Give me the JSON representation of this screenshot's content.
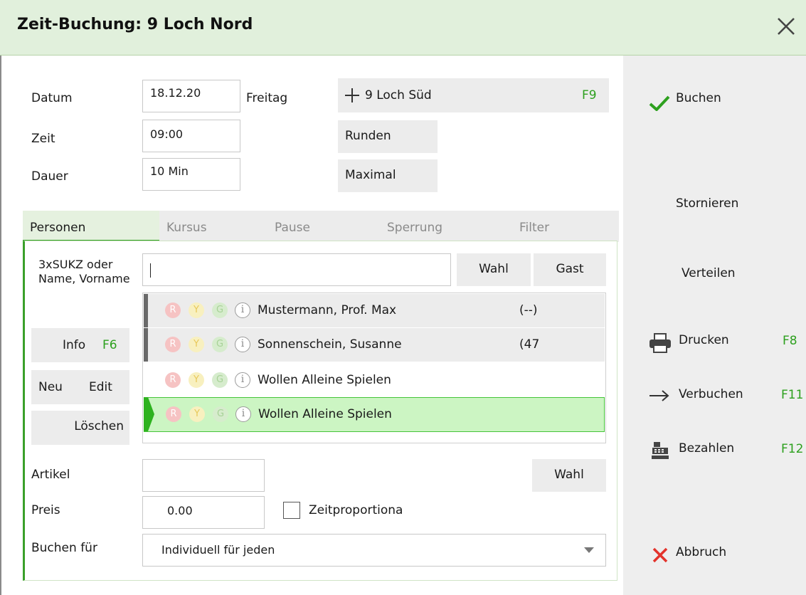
{
  "window": {
    "title": "Zeit-Buchung: 9 Loch Nord"
  },
  "form": {
    "datum_label": "Datum",
    "datum_value": "18.12.20",
    "weekday": "Freitag",
    "zeit_label": "Zeit",
    "zeit_value": "09:00",
    "dauer_label": "Dauer",
    "dauer_value": "10 Min"
  },
  "course_button": {
    "label": "9 Loch Süd",
    "key": "F9"
  },
  "runden_button": "Runden",
  "maximal_button": "Maximal",
  "tabs": [
    "Personen",
    "Kursus",
    "Pause",
    "Sperrung",
    "Filter"
  ],
  "search": {
    "label": "3xSUKZ oder Name, Vorname",
    "value": "",
    "wahl": "Wahl",
    "gast": "Gast"
  },
  "left_buttons": {
    "info": "Info",
    "info_key": "F6",
    "neu": "Neu",
    "edit": "Edit",
    "loeschen": "Löschen"
  },
  "persons": [
    {
      "name": "Mustermann, Prof. Max",
      "status": "(--)",
      "style": "gray"
    },
    {
      "name": "Sonnenschein, Susanne",
      "status": "(47",
      "style": "gray"
    },
    {
      "name": "Wollen Alleine Spielen",
      "status": "",
      "style": "plain"
    },
    {
      "name": "Wollen Alleine Spielen",
      "status": "",
      "style": "selected"
    }
  ],
  "status_letters": {
    "r": "R",
    "y": "Y",
    "g": "G",
    "i": "i"
  },
  "artikel": {
    "label": "Artikel",
    "value": "",
    "wahl": "Wahl"
  },
  "preis": {
    "label": "Preis",
    "value": "0.00",
    "zeitprop_label": "Zeitproportiona",
    "zeitprop_checked": false
  },
  "buchen_fuer": {
    "label": "Buchen für",
    "value": "Individuell für jeden"
  },
  "sidebar": {
    "buchen": "Buchen",
    "stornieren": "Stornieren",
    "verteilen": "Verteilen",
    "drucken": "Drucken",
    "drucken_key": "F8",
    "verbuchen": "Verbuchen",
    "verbuchen_key": "F11",
    "bezahlen": "Bezahlen",
    "bezahlen_key": "F12",
    "abbruch": "Abbruch"
  },
  "colors": {
    "accent_green": "#2da01e",
    "title_bg": "#e1f0dc",
    "selected_row": "#ccf5c3",
    "abbruch_red": "#e3322b"
  }
}
